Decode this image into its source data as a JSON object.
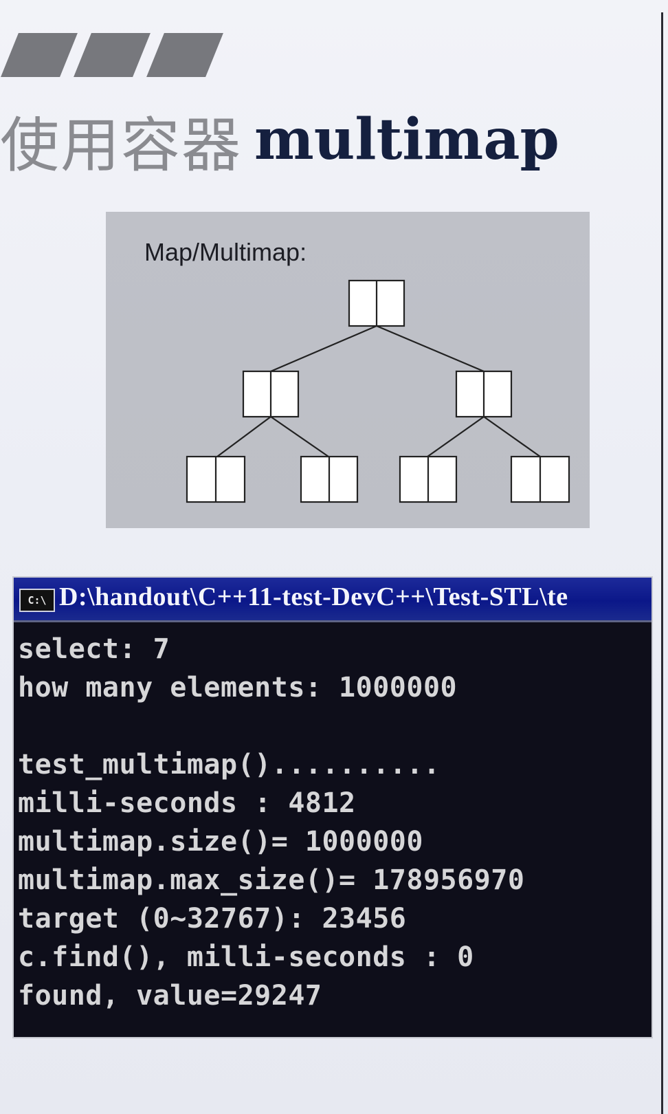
{
  "slide": {
    "title_cjk": "使用容器",
    "title_latin": "multimap"
  },
  "diagram": {
    "label": "Map/Multimap:",
    "node_count": 7
  },
  "console": {
    "icon_text": "C:\\",
    "title": "D:\\handout\\C++11-test-DevC++\\Test-STL\\te",
    "lines": [
      "select: 7",
      "how many elements: 1000000",
      "",
      "test_multimap()..........",
      "milli-seconds : 4812",
      "multimap.size()= 1000000",
      "multimap.max_size()= 178956970",
      "target (0~32767): 23456",
      "c.find(), milli-seconds : 0",
      "found, value=29247"
    ]
  },
  "colors": {
    "console_bg": "#0e0e1a",
    "console_titlebar": "#0b1789",
    "diagram_bg": "#bfc1c8",
    "title_latin": "#15203f"
  }
}
